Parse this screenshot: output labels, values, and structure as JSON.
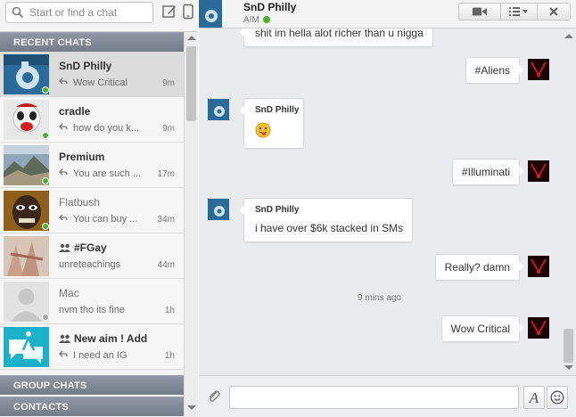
{
  "search": {
    "placeholder": "Start or find a chat"
  },
  "sidebar": {
    "recent_header": "RECENT CHATS",
    "group_header": "GROUP CHATS",
    "contacts_header": "CONTACTS",
    "chats": [
      {
        "name": "SnD Philly",
        "preview": "Wow Critical",
        "time": "9m",
        "status": "online",
        "group": false,
        "reply": true
      },
      {
        "name": "cradle",
        "preview": "how do you k...",
        "time": "9m",
        "status": "online",
        "group": false,
        "reply": true
      },
      {
        "name": "Premium",
        "preview": "You are such ...",
        "time": "17m",
        "status": "online",
        "group": false,
        "reply": true
      },
      {
        "name": "Flatbush",
        "preview": "You can buy ...",
        "time": "34m",
        "status": "online",
        "group": false,
        "reply": true
      },
      {
        "name": "#FGay",
        "preview": "unreteachings",
        "time": "44m",
        "status": "none",
        "group": true,
        "reply": false
      },
      {
        "name": "Mac",
        "preview": "nvm tho its fine",
        "time": "1h",
        "status": "offline",
        "group": false,
        "reply": false
      },
      {
        "name": "New aim ! Add",
        "preview": "I need an IG",
        "time": "1h",
        "status": "none",
        "group": true,
        "reply": true
      }
    ]
  },
  "conversation": {
    "title": "SnD Philly",
    "status": "AIM",
    "messages": [
      {
        "direction": "in",
        "text": "shit im hella alot richer than u nigga"
      },
      {
        "direction": "out",
        "text": "#Aliens"
      },
      {
        "direction": "in",
        "sender": "SnD Philly",
        "text": "",
        "emoji": "tongue-face"
      },
      {
        "direction": "out",
        "text": "#Illuminati"
      },
      {
        "direction": "in",
        "sender": "SnD Philly",
        "text": "i have over $6k stacked in SMs"
      },
      {
        "direction": "out",
        "text": "Really? damn"
      },
      {
        "direction": "out",
        "text": "Wow Critical"
      }
    ],
    "timestamp": "9 mins ago"
  },
  "composer": {
    "font_label": "A"
  },
  "icons": {
    "search": "search-icon",
    "compose": "compose-icon",
    "mobile": "mobile-icon",
    "video": "video-icon",
    "menu": "list-menu-icon",
    "close": "close-icon",
    "attach": "paperclip-icon",
    "font": "font-icon",
    "emoji": "smiley-icon",
    "reply": "reply-arrow-icon",
    "group": "group-icon"
  },
  "colors": {
    "online": "#4caf2c",
    "offline": "#a5a5a5",
    "header_gradient_top": "#8e97a3",
    "header_gradient_bottom": "#737c89",
    "chat_bg": "#e9ebee"
  }
}
